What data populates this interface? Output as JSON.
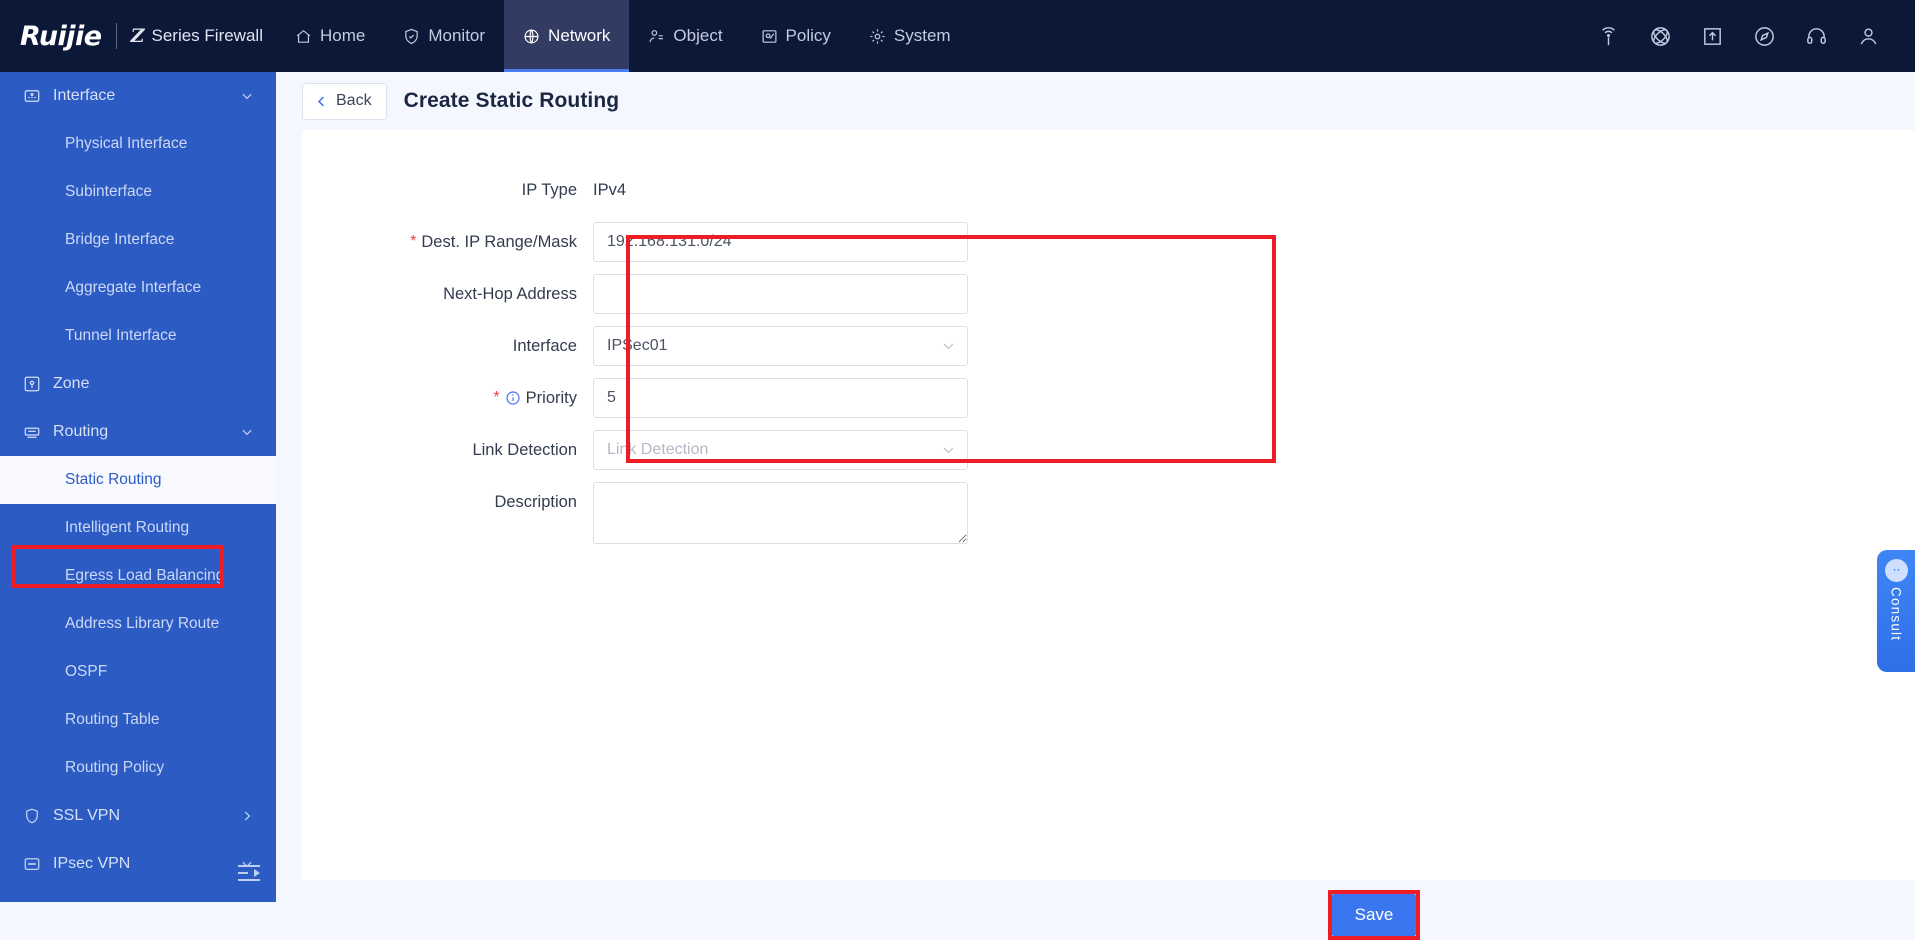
{
  "topbar": {
    "logo": "Ruijie",
    "z_mark": "Z",
    "product": "Series Firewall",
    "nav": [
      {
        "label": "Home",
        "icon": "home-icon",
        "active": false
      },
      {
        "label": "Monitor",
        "icon": "shield-icon",
        "active": false
      },
      {
        "label": "Network",
        "icon": "globe-icon",
        "active": true
      },
      {
        "label": "Object",
        "icon": "person-icon",
        "active": false
      },
      {
        "label": "Policy",
        "icon": "policy-icon",
        "active": false
      },
      {
        "label": "System",
        "icon": "gear-icon",
        "active": false
      }
    ],
    "right_icons": [
      "wireless-signal-icon",
      "network-globe-icon",
      "upload-box-icon",
      "compass-icon",
      "headset-icon",
      "user-account-icon"
    ]
  },
  "sidebar": {
    "items": [
      {
        "type": "group",
        "label": "Interface",
        "icon": "interface-icon",
        "expanded": true
      },
      {
        "type": "sub",
        "label": "Physical Interface"
      },
      {
        "type": "sub",
        "label": "Subinterface"
      },
      {
        "type": "sub",
        "label": "Bridge Interface"
      },
      {
        "type": "sub",
        "label": "Aggregate Interface"
      },
      {
        "type": "sub",
        "label": "Tunnel Interface"
      },
      {
        "type": "group",
        "label": "Zone",
        "icon": "zone-icon",
        "expanded": null
      },
      {
        "type": "group",
        "label": "Routing",
        "icon": "routing-icon",
        "expanded": true
      },
      {
        "type": "sub",
        "label": "Static Routing",
        "selected": true
      },
      {
        "type": "sub",
        "label": "Intelligent Routing"
      },
      {
        "type": "sub",
        "label": "Egress Load Balancing"
      },
      {
        "type": "sub",
        "label": "Address Library Route"
      },
      {
        "type": "sub",
        "label": "OSPF"
      },
      {
        "type": "sub",
        "label": "Routing Table"
      },
      {
        "type": "sub",
        "label": "Routing Policy"
      },
      {
        "type": "group",
        "label": "SSL VPN",
        "icon": "ssl-vpn-icon",
        "expanded": false
      },
      {
        "type": "group",
        "label": "IPsec VPN",
        "icon": "ipsec-vpn-icon",
        "expanded": true
      }
    ],
    "collapse_icon": "collapse-sidebar-icon"
  },
  "page": {
    "back_label": "Back",
    "title": "Create Static Routing"
  },
  "form": {
    "ip_type": {
      "label": "IP Type",
      "value": "IPv4"
    },
    "dest_ip": {
      "label": "Dest. IP Range/Mask",
      "required": "*",
      "value": "192.168.131.0/24",
      "placeholder": ""
    },
    "next_hop": {
      "label": "Next-Hop Address",
      "value": "",
      "placeholder": ""
    },
    "interface": {
      "label": "Interface",
      "value": "IPSec01",
      "chevron": "chevron-down-icon"
    },
    "priority": {
      "label": "Priority",
      "required": "*",
      "info_icon": "info-circle-icon",
      "value": "5",
      "placeholder": ""
    },
    "link_detection": {
      "label": "Link Detection",
      "value": "",
      "placeholder": "Link Detection",
      "chevron": "chevron-down-icon"
    },
    "description": {
      "label": "Description",
      "value": "",
      "placeholder": ""
    }
  },
  "footer": {
    "save_label": "Save"
  },
  "consult": {
    "label": "Consult",
    "icon": "consult-avatar-icon"
  },
  "colors": {
    "topbar_bg": "#0c1837",
    "sidebar_bg": "#2c5bc4",
    "accent": "#3a76f0",
    "highlight_red": "#ee1c25",
    "required_red": "#e8453c",
    "page_bg": "#f4f7fd"
  }
}
